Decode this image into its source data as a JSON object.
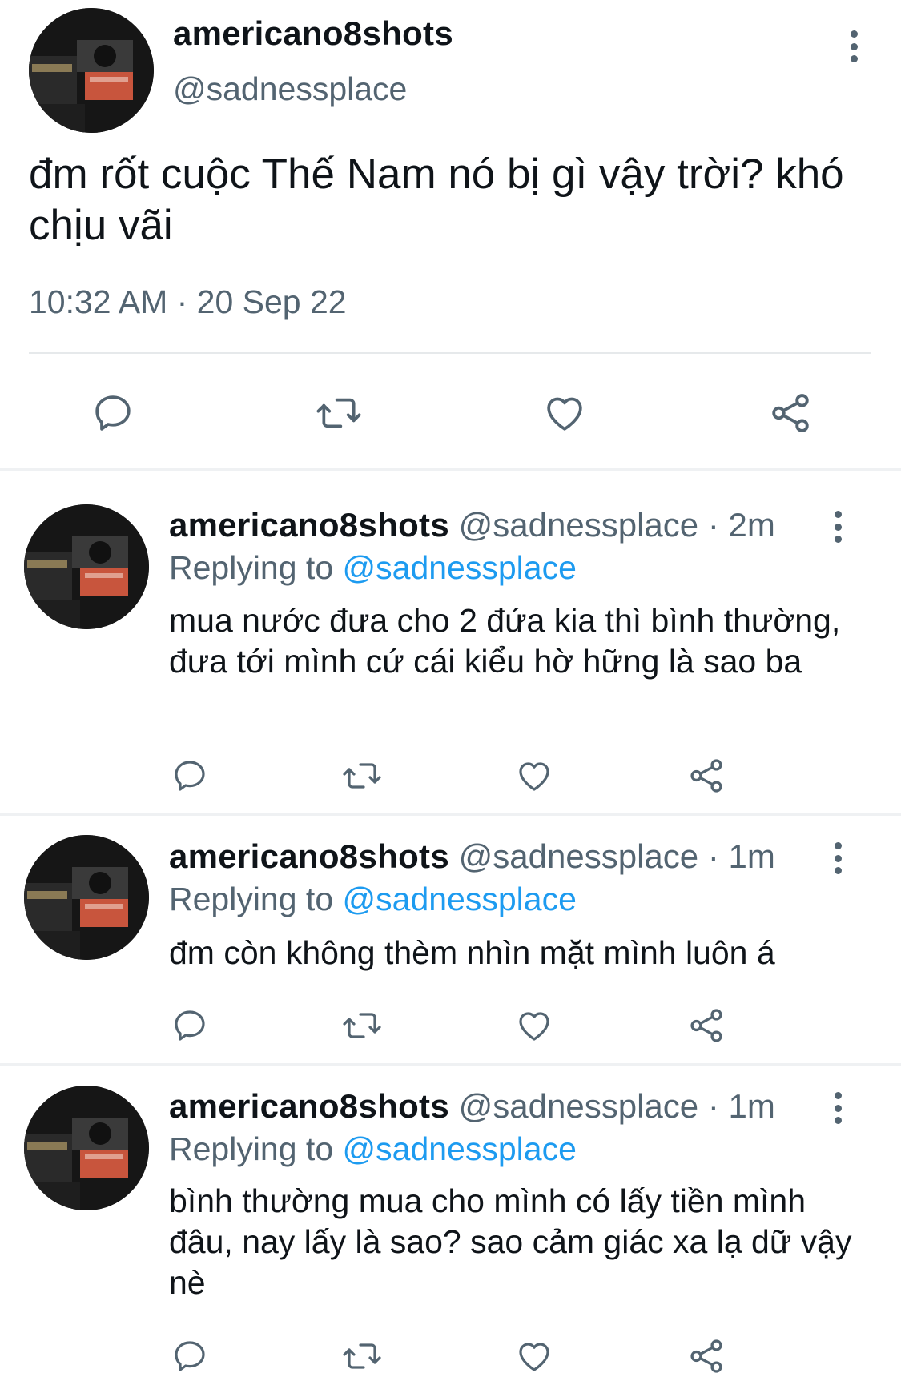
{
  "main_tweet": {
    "display_name": "americano8shots",
    "handle": "@sadnessplace",
    "text": "đm rốt cuộc Thế Nam nó bị gì vậy trời? khó chịu vãi",
    "timestamp": "10:32 AM · 20 Sep 22"
  },
  "replies": [
    {
      "display_name": "americano8shots",
      "handle": "@sadnessplace",
      "age": "· 2m",
      "replying_prefix": "Replying to",
      "replying_handle": "@sadnessplace",
      "text": "mua nước đưa cho 2 đứa kia thì bình thường, đưa tới mình cứ cái kiểu hờ hững là sao ba"
    },
    {
      "display_name": "americano8shots",
      "handle": "@sadnessplace",
      "age": "· 1m",
      "replying_prefix": "Replying to",
      "replying_handle": "@sadnessplace",
      "text": "đm còn không thèm nhìn mặt mình luôn á"
    },
    {
      "display_name": "americano8shots",
      "handle": "@sadnessplace",
      "age": "· 1m",
      "replying_prefix": "Replying to",
      "replying_handle": "@sadnessplace",
      "text": "bình thường mua cho mình có lấy tiền mình đâu, nay lấy là sao? sao cảm giác xa lạ dữ vậy nè"
    }
  ],
  "icons": [
    "more-icon",
    "reply-icon",
    "retweet-icon",
    "like-icon",
    "share-icon"
  ],
  "colors": {
    "text": "#0f1419",
    "secondary": "#536471",
    "link": "#1d9bf0",
    "divider": "#eff1f3"
  }
}
